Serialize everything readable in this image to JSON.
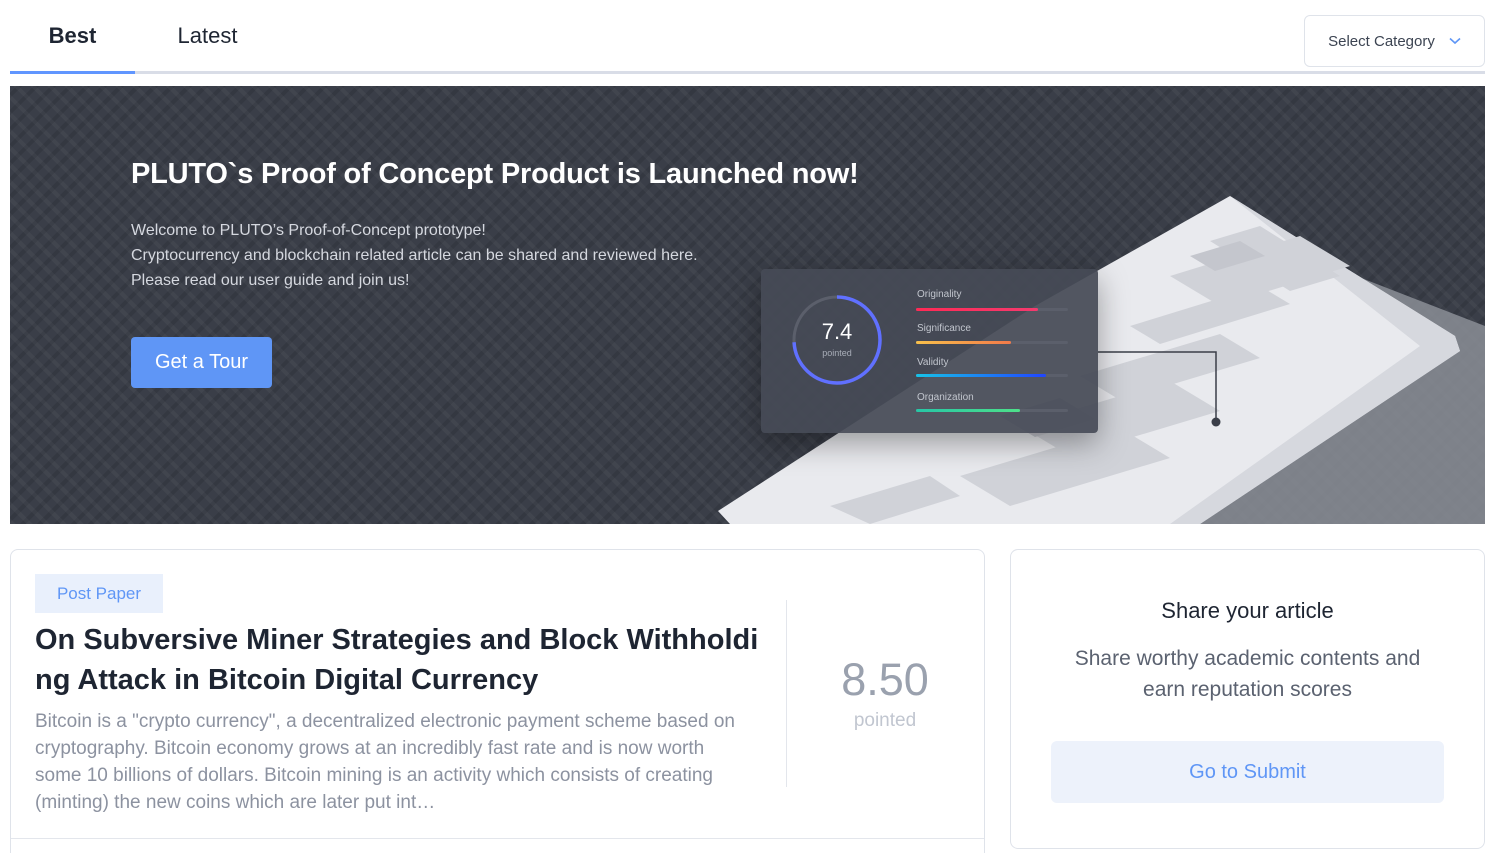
{
  "tabs": [
    {
      "label": "Best",
      "active": true
    },
    {
      "label": "Latest",
      "active": false
    }
  ],
  "category_select": {
    "label": "Select Category",
    "icon": "chevron-down-icon"
  },
  "banner": {
    "title": "PLUTO`s Proof of Concept Product is Launched now!",
    "description": [
      "Welcome to PLUTO’s Proof-of-Concept prototype!",
      "Cryptocurrency and blockchain related article can be shared and reviewed here.",
      "Please read our user guide and join us!"
    ],
    "tour_button": "Get a Tour",
    "score_card": {
      "value": "7.4",
      "value_label": "pointed",
      "metrics": [
        {
          "label": "Originality",
          "color": "#ef2f5f"
        },
        {
          "label": "Significance",
          "color": "#f5a24b"
        },
        {
          "label": "Validity",
          "color": "#1f8bf0"
        },
        {
          "label": "Organization",
          "color": "#3fd49a"
        }
      ]
    }
  },
  "article": {
    "badge": "Post Paper",
    "title": "On Subversive Miner Strategies and Block Withholding Attack in Bitcoin Digital Currency",
    "abstract": "Bitcoin is a \"crypto currency\", a decentralized electronic payment scheme based on cryptography. Bitcoin economy grows at an incredibly fast rate and is now worth some 10 billions of dollars. Bitcoin mining is an activity which consists of creating (minting) the new coins which are later put int…",
    "score": "8.50",
    "score_label": "pointed"
  },
  "share": {
    "title": "Share your article",
    "description": "Share worthy academic contents and earn reputation scores",
    "button": "Go to Submit"
  },
  "colors": {
    "accent": "#5f96f6",
    "banner_bg": "#3a3e48",
    "text_primary": "#1e2532",
    "text_muted": "#8c92a0"
  }
}
